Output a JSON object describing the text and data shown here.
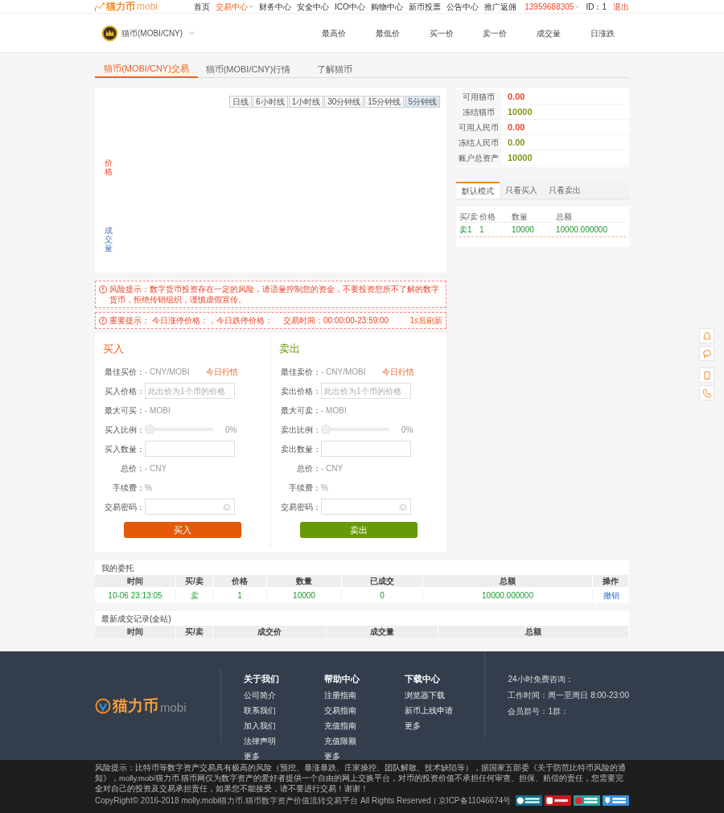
{
  "top_nav": {
    "logo": {
      "name": "猫力币",
      "suffix": "mobi"
    },
    "menu": [
      {
        "label": "首页",
        "selected": false,
        "has_menu": false
      },
      {
        "label": "交易中心",
        "selected": true,
        "has_menu": true
      },
      {
        "label": "财务中心",
        "selected": false,
        "has_menu": false
      },
      {
        "label": "安全中心",
        "selected": false,
        "has_menu": false
      },
      {
        "label": "ICO中心",
        "selected": false,
        "has_menu": false
      },
      {
        "label": "购物中心",
        "selected": false,
        "has_menu": false
      },
      {
        "label": "新币投票",
        "selected": false,
        "has_menu": false
      },
      {
        "label": "公告中心",
        "selected": false,
        "has_menu": false
      },
      {
        "label": "推广返佣",
        "selected": false,
        "has_menu": false
      }
    ],
    "user": {
      "phone": "13959688305",
      "id": "ID：1",
      "logout": "退出"
    }
  },
  "market": {
    "coin": "猫币(MOBI/CNY)",
    "stats": [
      "最高价",
      "最低价",
      "买一价",
      "卖一价",
      "成交量",
      "日涨跌"
    ]
  },
  "tabs": [
    {
      "label": "猫币(MOBI/CNY)交易",
      "selected": true
    },
    {
      "label": "猫币(MOBI/CNY)行情",
      "selected": false
    },
    {
      "label": "了解猫币",
      "selected": false
    }
  ],
  "chart": {
    "periods": [
      {
        "label": "日线",
        "selected": false
      },
      {
        "label": "6小时线",
        "selected": false
      },
      {
        "label": "1小时线",
        "selected": false
      },
      {
        "label": "30分钟线",
        "selected": false
      },
      {
        "label": "15分钟线",
        "selected": false
      },
      {
        "label": "5分钟线",
        "selected": true
      }
    ],
    "price_axis": "价格",
    "volume_axis": "成交量"
  },
  "balances": [
    {
      "label": "可用猫币",
      "value": "0.00",
      "color": "#e8452c"
    },
    {
      "label": "冻结猫币",
      "value": "10000",
      "color": "#7a9a1a"
    },
    {
      "label": "可用人民币",
      "value": "0.00",
      "color": "#e8452c"
    },
    {
      "label": "冻结人民币",
      "value": "0.00",
      "color": "#7a9a1a"
    },
    {
      "label": "账户总资产",
      "value": "10000",
      "color": "#7a9a1a"
    }
  ],
  "order_modes": [
    {
      "label": "默认模式",
      "selected": true
    },
    {
      "label": "只看买入",
      "selected": false
    },
    {
      "label": "只看卖出",
      "selected": false
    }
  ],
  "order_book": {
    "columns": [
      "买/卖",
      "价格",
      "数量",
      "总额"
    ],
    "rows": [
      [
        "卖1",
        "1",
        "10000",
        "10000.000000"
      ]
    ]
  },
  "notices": {
    "risk": "风险提示：数字货币投资存在一定的风险，请适量控制您的资金，不要投资您所不了解的数字货币，拒绝传销组织，谨慎虚假宣传。",
    "important": {
      "label": "重要提示：",
      "limits": "今日涨停价格：，今日跌停价格：",
      "hours": "交易时间：00:00:00-23:59:00",
      "refresh": "1s后刷新"
    }
  },
  "trade_forms": [
    {
      "kind": "buy",
      "title": "买入",
      "best_price_label": "最佳买价：",
      "best_price": "- CNY/MOBI",
      "market_link": "今日行情",
      "price_label": "买入价格：",
      "price_placeholder": "此出价为1个币的价格",
      "max_label": "最大可买：",
      "max_value": "- MOBI",
      "ratio_label": "买入比例：",
      "level": 0,
      "ratio": "0%",
      "amount_label": "买入数量：",
      "total_label": "总价：",
      "total": "- CNY",
      "fee_label": "手续费：",
      "fee": "%",
      "password_label": "交易密码：",
      "button": "买入"
    },
    {
      "kind": "sell",
      "title": "卖出",
      "best_price_label": "最佳卖价：",
      "best_price": "- CNY/MOBI",
      "market_link": "今日行情",
      "price_label": "卖出价格：",
      "price_placeholder": "此出价为1个币的价格",
      "max_label": "最大可卖：",
      "max_value": "- MOBI",
      "ratio_label": "卖出比例：",
      "level": 0,
      "ratio": "0%",
      "amount_label": "卖出数量：",
      "total_label": "总价：",
      "total": "- CNY",
      "fee_label": "手续费：",
      "fee": "%",
      "password_label": "交易密码：",
      "button": "卖出"
    }
  ],
  "my_orders": {
    "title": "我的委托",
    "columns": [
      "时间",
      "买/卖",
      "价格",
      "数量",
      "已成交",
      "总额",
      "操作"
    ],
    "rows": [
      {
        "cells": [
          "10-06 23:13:05",
          "卖",
          "1",
          "10000",
          "0",
          "10000.000000"
        ],
        "action": "撤销"
      }
    ]
  },
  "trades": {
    "title": "最新成交记录(全站)",
    "columns": [
      "时间",
      "买/卖",
      "成交价",
      "成交量",
      "总额"
    ]
  },
  "footer": {
    "logo": {
      "name": "猫力币",
      "suffix": "mobi"
    },
    "columns": [
      {
        "title": "关于我们",
        "links": [
          "公司简介",
          "联系我们",
          "加入我们",
          "法律声明",
          "更多"
        ]
      },
      {
        "title": "帮助中心",
        "links": [
          "注册指南",
          "交易指南",
          "充值指南",
          "充值限额",
          "更多"
        ]
      },
      {
        "title": "下载中心",
        "links": [
          "浏览器下载",
          "新币上线申请",
          "更多"
        ]
      }
    ],
    "contact": [
      "24小时免费咨询：",
      "工作时间：周一至周日 8:00-23:00",
      "会员群号：1群："
    ],
    "risk": "风险提示：比特币等数字资产交易具有极高的风险（预挖、暴涨暴跌、庄家操控、团队解散、技术缺陷等），据国家五部委《关于防范比特币风险的通知》，molly.mobi猫力币.猫币网仅为数字资产的爱好者提供一个自由的网上交换平台，对币的投资价值不承担任何审查、担保、赔偿的责任，您需要完全对自己的投资及交易承担责任，如果您不能接受，请不要进行交易！谢谢！",
    "copyright": "CopyRight© 2016-2018 molly.mobi猫力币.猫币数字资产价值流转交易平台 All Rights Reserved",
    "icp": "京ICP备11046674号"
  }
}
